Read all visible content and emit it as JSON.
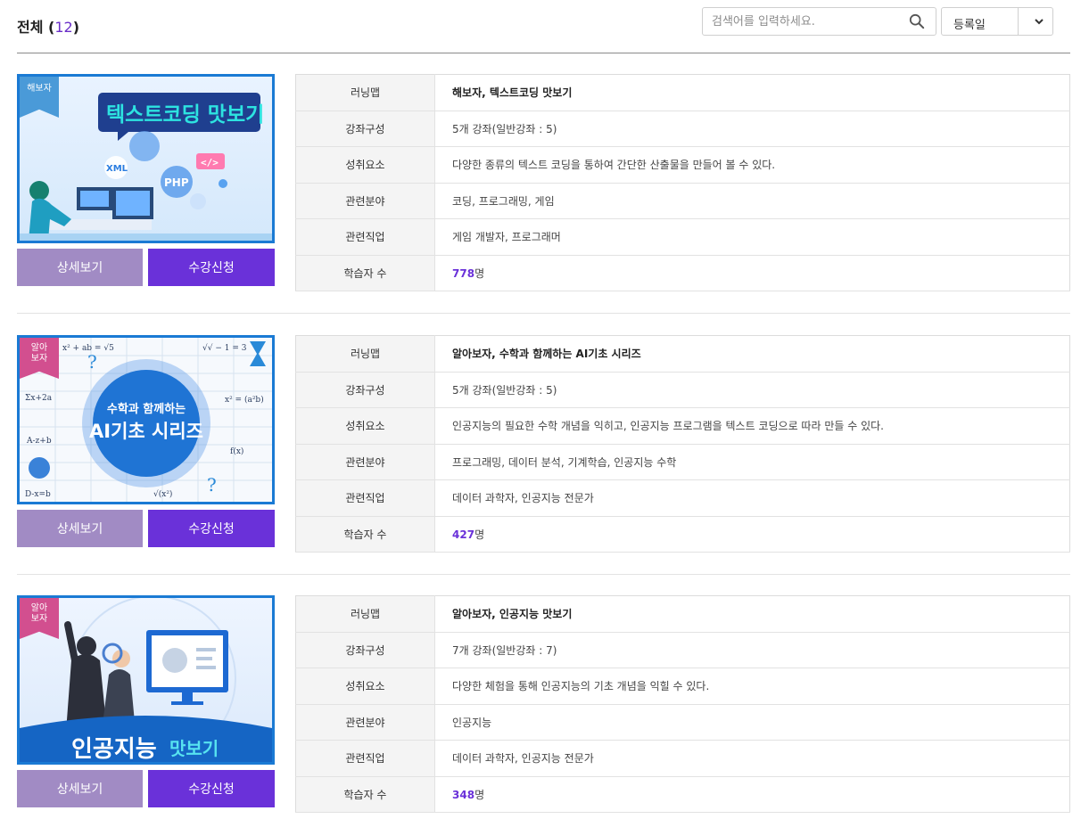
{
  "header": {
    "title_prefix": "전체 (",
    "count": "12",
    "title_suffix": ")",
    "search_placeholder": "검색어를 입력하세요.",
    "sort_label": "등록일"
  },
  "row_labels": {
    "roadmap": "러닝맵",
    "structure": "강좌구성",
    "achievement": "성취요소",
    "field": "관련분야",
    "job": "관련직업",
    "learners": "학습자 수"
  },
  "buttons": {
    "detail": "상세보기",
    "apply": "수강신청"
  },
  "courses": [
    {
      "badge": "해보자",
      "thumb_title": "텍스트코딩 맛보기",
      "roadmap": "해보자, 텍스트코딩 맛보기",
      "structure": "5개 강좌(일반강좌 : 5)",
      "achievement": "다양한 종류의 텍스트 코딩을 통하여 간단한 산출물을 만들어 볼 수 있다.",
      "field": "코딩, 프로그래밍, 게임",
      "job": "게임 개발자, 프로그래머",
      "learners_count": "778",
      "learners_unit": "명"
    },
    {
      "badge": "알아\n보자",
      "thumb_title_1": "수학과 함께하는",
      "thumb_title_2": "AI기초 시리즈",
      "roadmap": "알아보자, 수학과 함께하는 AI기초 시리즈",
      "structure": "5개 강좌(일반강좌 : 5)",
      "achievement": "인공지능의 필요한 수학 개념을 익히고, 인공지능 프로그램을 텍스트 코딩으로 따라 만들 수 있다.",
      "field": "프로그래밍, 데이터 분석, 기계학습, 인공지능 수학",
      "job": "데이터 과학자, 인공지능 전문가",
      "learners_count": "427",
      "learners_unit": "명"
    },
    {
      "badge": "알아\n보자",
      "thumb_title_1": "인공지능",
      "thumb_title_2": "맛보기",
      "roadmap": "알아보자, 인공지능 맛보기",
      "structure": "7개 강좌(일반강좌 : 7)",
      "achievement": "다양한 체험을 통해 인공지능의 기초 개념을 익힐 수 있다.",
      "field": "인공지능",
      "job": "데이터 과학자, 인공지능 전문가",
      "learners_count": "348",
      "learners_unit": "명"
    }
  ],
  "colors": {
    "accent": "#6a31d9",
    "detail_button": "#a18bc4",
    "thumb_border": "#1a7ad4"
  }
}
